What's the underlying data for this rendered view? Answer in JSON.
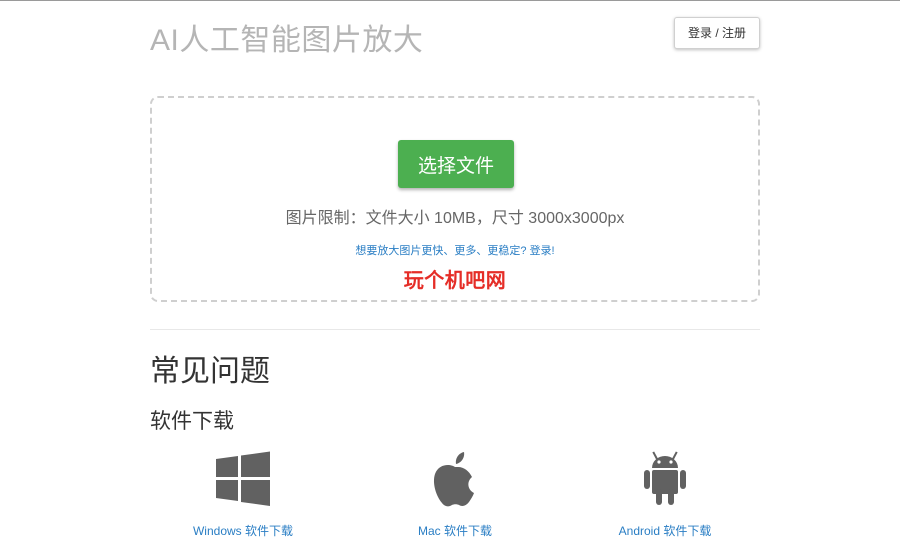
{
  "header": {
    "title": "AI人工智能图片放大",
    "login_label": "登录 / 注册"
  },
  "upload": {
    "select_label": "选择文件",
    "limits_text": "图片限制：文件大小 10MB，尺寸 3000x3000px",
    "promo_text": "想要放大图片更快、更多、更稳定? 登录!",
    "watermark_text": "玩个机吧网"
  },
  "faq": {
    "title": "常见问题",
    "download_title": "软件下载",
    "downloads": [
      {
        "label": "Windows 软件下载",
        "icon": "windows-icon"
      },
      {
        "label": "Mac 软件下载",
        "icon": "apple-icon"
      },
      {
        "label": "Android 软件下载",
        "icon": "android-icon"
      }
    ]
  },
  "colors": {
    "accent_green": "#4caf50",
    "link_blue": "#2a7ec4",
    "watermark_red": "#e52d27",
    "icon_gray": "#616161"
  }
}
